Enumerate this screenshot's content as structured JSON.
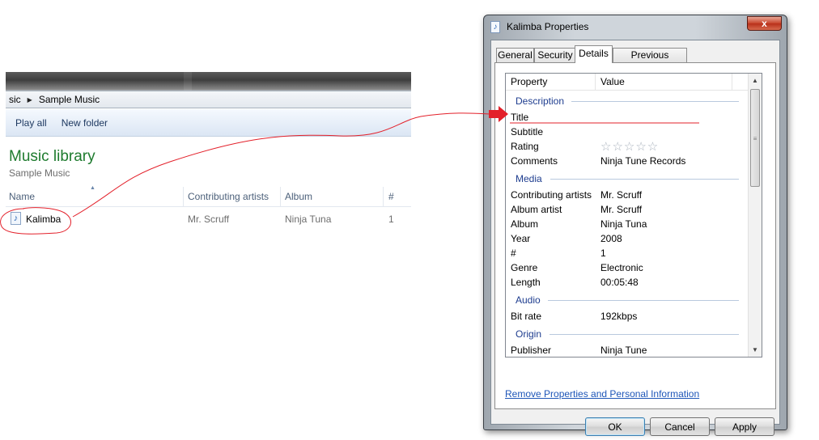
{
  "explorer": {
    "breadcrumb": [
      "sic",
      "Sample Music"
    ],
    "toolbar": [
      "Play all",
      "New folder"
    ],
    "library_title": "Music library",
    "library_subtitle": "Sample Music",
    "columns": [
      "Name",
      "Contributing artists",
      "Album",
      "#"
    ],
    "row": {
      "name": "Kalimba",
      "artist": "Mr. Scruff",
      "album": "Ninja Tuna",
      "track": "1"
    }
  },
  "dialog": {
    "title": "Kalimba Properties",
    "close_label": "x",
    "tabs": [
      "General",
      "Security",
      "Details",
      "Previous Versions"
    ],
    "active_tab": "Details",
    "list_headers": [
      "Property",
      "Value"
    ],
    "groups": [
      {
        "label": "Description",
        "rows": [
          {
            "k": "Title",
            "v": ""
          },
          {
            "k": "Subtitle",
            "v": ""
          },
          {
            "k": "Rating",
            "v": "☆☆☆☆☆"
          },
          {
            "k": "Comments",
            "v": "Ninja Tune Records"
          }
        ]
      },
      {
        "label": "Media",
        "rows": [
          {
            "k": "Contributing artists",
            "v": "Mr. Scruff"
          },
          {
            "k": "Album artist",
            "v": "Mr. Scruff"
          },
          {
            "k": "Album",
            "v": "Ninja Tuna"
          },
          {
            "k": "Year",
            "v": "2008"
          },
          {
            "k": "#",
            "v": "1"
          },
          {
            "k": "Genre",
            "v": "Electronic"
          },
          {
            "k": "Length",
            "v": "00:05:48"
          }
        ]
      },
      {
        "label": "Audio",
        "rows": [
          {
            "k": "Bit rate",
            "v": "192kbps"
          }
        ]
      },
      {
        "label": "Origin",
        "rows": [
          {
            "k": "Publisher",
            "v": "Ninja Tune"
          }
        ]
      }
    ],
    "remove_link": "Remove Properties and Personal Information",
    "buttons": {
      "ok": "OK",
      "cancel": "Cancel",
      "apply": "Apply"
    }
  },
  "colors": {
    "annotation_red": "#e3202a",
    "library_green": "#1e7b2e",
    "group_blue": "#1e3d8f"
  }
}
